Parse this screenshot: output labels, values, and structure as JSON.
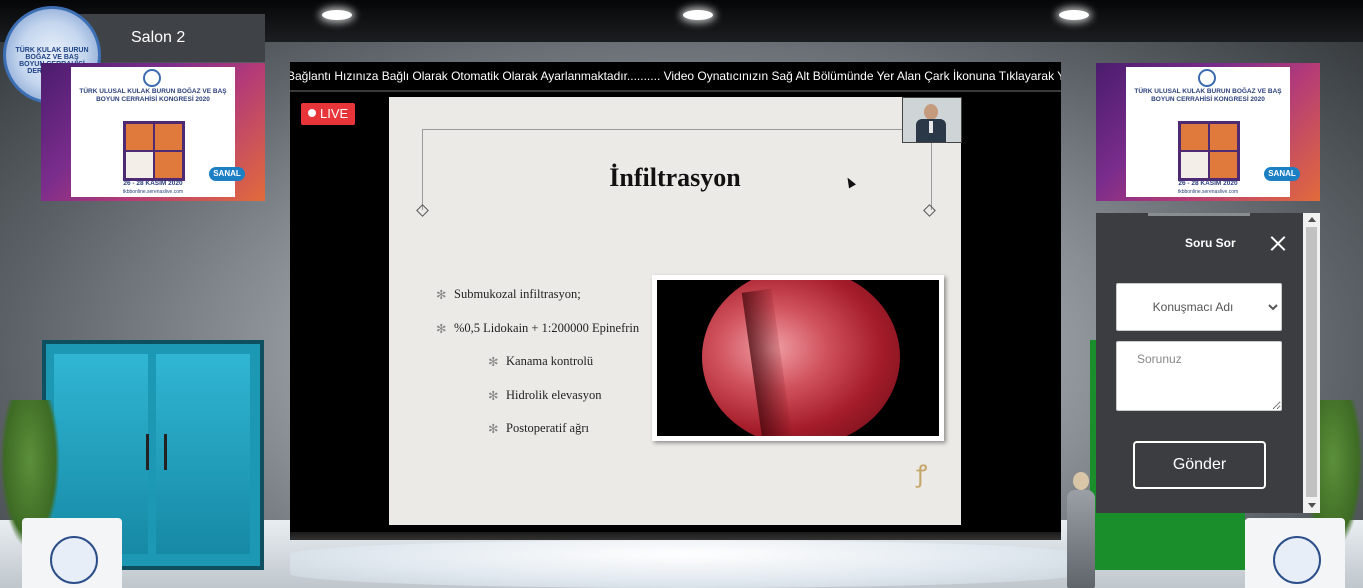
{
  "salon": {
    "label": "Salon 2"
  },
  "logo": {
    "text": "TÜRK KULAK BURUN BOĞAZ VE BAŞ BOYUN CERRAHİSİ DERNEĞİ 1928"
  },
  "banners": {
    "title": "TÜRK ULUSAL KULAK BURUN BOĞAZ VE BAŞ BOYUN CERRAHİSİ KONGRESİ 2020",
    "dates": "26 - 28 KASIM 2020",
    "url": "tkbbonline.serenaslive.com",
    "badge": "SANAL"
  },
  "ticker": {
    "text": "Bağlantı Hızınıza Bağlı Olarak Otomatik Olarak Ayarlanmaktadır.......... Video Oynatıcınızın Sağ Alt Bölümünde Yer Alan Çark İkonuna Tıklayarak Yayın Kal"
  },
  "live": {
    "label": "LIVE"
  },
  "slide": {
    "title": "İnfiltrasyon",
    "bullets": [
      {
        "text": "Submukozal infiltrasyon;",
        "level": 1
      },
      {
        "text": "%0,5 Lidokain + 1:200000 Epinefrin",
        "level": 1
      },
      {
        "text": "Kanama kontrolü",
        "level": 2
      },
      {
        "text": "Hidrolik elevasyon",
        "level": 2
      },
      {
        "text": "Postoperatif ağrı",
        "level": 2
      }
    ]
  },
  "question_panel": {
    "title": "Soru Sor",
    "speaker_select": {
      "selected": "Konuşmacı Adı",
      "options": [
        "Konuşmacı Adı"
      ]
    },
    "question_placeholder": "Sorunuz",
    "submit_label": "Gönder"
  },
  "icons": {
    "close": "close-icon",
    "live_dot": "record-dot-icon",
    "bullet": "asterisk-icon"
  },
  "colors": {
    "live": "#e8353a",
    "panel_bg": "#3b3d40",
    "door_blue": "#1c97b4",
    "door_green": "#1a8e2a"
  }
}
